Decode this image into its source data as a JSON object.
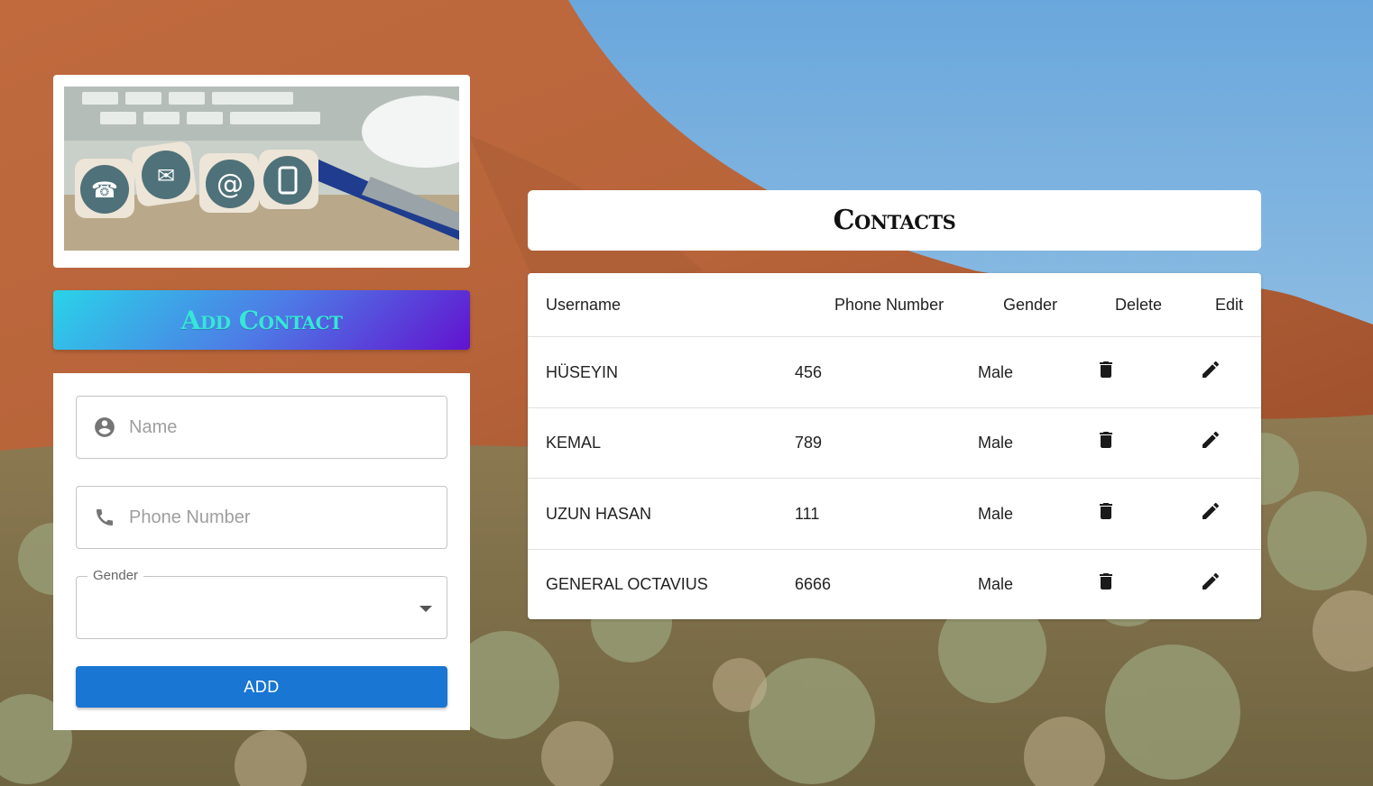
{
  "form": {
    "title": "Add Contact",
    "name_placeholder": "Name",
    "phone_placeholder": "Phone Number",
    "gender_label": "Gender",
    "gender_value": "",
    "add_button": "ADD"
  },
  "contacts": {
    "title": "Contacts",
    "headers": {
      "username": "Username",
      "phone": "Phone Number",
      "gender": "Gender",
      "delete": "Delete",
      "edit": "Edit"
    },
    "rows": [
      {
        "username": "HÜSEYIN",
        "phone": "456",
        "gender": "Male"
      },
      {
        "username": "KEMAL",
        "phone": "789",
        "gender": "Male"
      },
      {
        "username": "UZUN HASAN",
        "phone": "111",
        "gender": "Male"
      },
      {
        "username": "GENERAL OCTAVIUS",
        "phone": "6666",
        "gender": "Male"
      }
    ]
  },
  "icons": {
    "name_field": "account-circle-icon",
    "phone_field": "phone-icon",
    "gender_dropdown": "arrow-drop-down-icon",
    "delete": "trash-icon",
    "edit": "pencil-icon"
  },
  "colors": {
    "add_button": "#1976d2",
    "title_gradient_start": "#2ad3e8",
    "title_gradient_end": "#6212d0",
    "title_text": "#36e7d7"
  }
}
